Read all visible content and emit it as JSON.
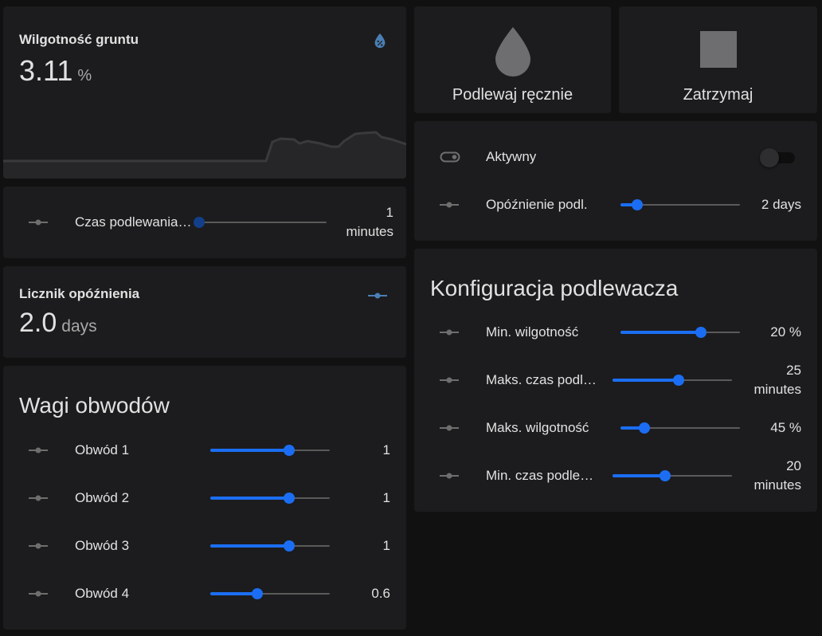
{
  "colors": {
    "background": "#111111",
    "card": "#1c1c1e",
    "accent": "#1b6ef3",
    "accent_dim": "#133f8a",
    "text": "#e1e1e1",
    "icon": "#6e6e6e",
    "icon_blue": "#4a7fb5"
  },
  "soil_moisture": {
    "title": "Wilgotność gruntu",
    "value": "3.11",
    "unit": "%",
    "icon": "water-percent-icon"
  },
  "watering_time": {
    "label": "Czas podlewania…",
    "value": "1",
    "unit": "minutes",
    "level": 0.0,
    "icon": "slider-icon"
  },
  "delay_counter": {
    "title": "Licznik opóźnienia",
    "value": "2.0",
    "unit": "days",
    "icon": "slider-icon"
  },
  "circuit_weights": {
    "heading": "Wagi obwodów",
    "items": [
      {
        "label": "Obwód 1",
        "value": "1",
        "level": 0.66
      },
      {
        "label": "Obwód 2",
        "value": "1",
        "level": 0.66
      },
      {
        "label": "Obwód 3",
        "value": "1",
        "level": 0.66
      },
      {
        "label": "Obwód 4",
        "value": "0.6",
        "level": 0.39
      }
    ]
  },
  "actions": {
    "water_manually": {
      "label": "Podlewaj ręcznie",
      "icon": "water-drop-icon"
    },
    "stop": {
      "label": "Zatrzymaj",
      "icon": "stop-icon"
    }
  },
  "controls": {
    "active": {
      "label": "Aktywny",
      "state": "off",
      "icon": "toggle-switch-icon"
    },
    "watering_delay": {
      "label": "Opóźnienie podl.",
      "value": "2 days",
      "level": 0.14,
      "icon": "slider-icon"
    }
  },
  "config": {
    "heading": "Konfiguracja podlewacza",
    "items": [
      {
        "label": "Min. wilgotność",
        "value": "20 %",
        "level": 0.67
      },
      {
        "label": "Maks. czas podl…",
        "value": "25",
        "unit": "minutes",
        "level": 0.55
      },
      {
        "label": "Maks. wilgotność",
        "value": "45 %",
        "level": 0.2
      },
      {
        "label": "Min. czas podle…",
        "value": "20",
        "unit": "minutes",
        "level": 0.44
      }
    ]
  }
}
